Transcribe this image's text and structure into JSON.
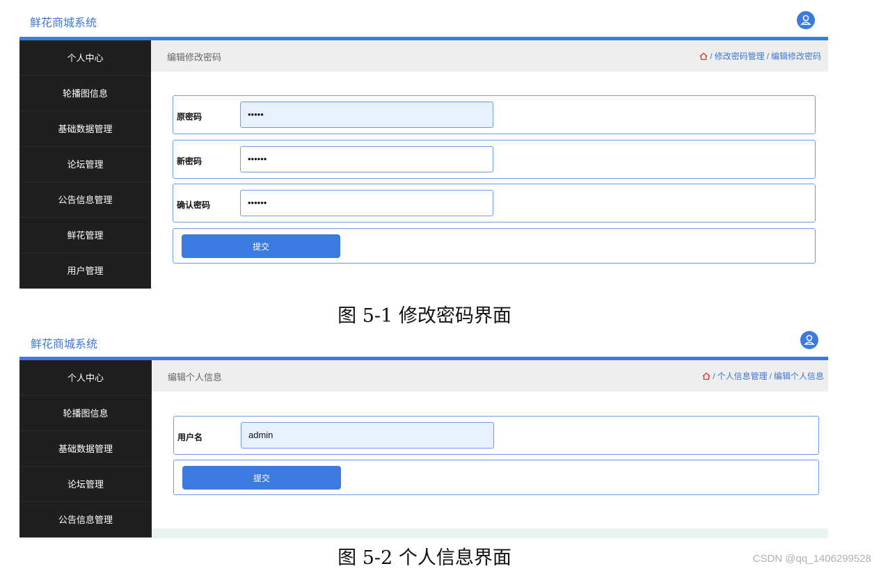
{
  "figures": [
    {
      "brand": "鲜花商城系统",
      "sidebar": [
        "个人中心",
        "轮播图信息",
        "基础数据管理",
        "论坛管理",
        "公告信息管理",
        "鲜花管理",
        "用户管理"
      ],
      "page_title": "编辑修改密码",
      "breadcrumb": [
        "修改密码管理",
        "编辑修改密码"
      ],
      "fields": [
        {
          "label": "原密码",
          "value": "•••••"
        },
        {
          "label": "新密码",
          "value": "••••••"
        },
        {
          "label": "确认密码",
          "value": "••••••"
        }
      ],
      "submit": "提交",
      "caption": "图 5-1 修改密码界面"
    },
    {
      "brand": "鲜花商城系统",
      "sidebar": [
        "个人中心",
        "轮播图信息",
        "基础数据管理",
        "论坛管理",
        "公告信息管理"
      ],
      "page_title": "编辑个人信息",
      "breadcrumb": [
        "个人信息管理",
        "编辑个人信息"
      ],
      "fields": [
        {
          "label": "用户名",
          "value": "admin"
        }
      ],
      "submit": "提交",
      "caption": "图 5-2 个人信息界面"
    }
  ],
  "watermark": "CSDN @qq_1406299528",
  "colors": {
    "accent": "#3b7be0",
    "sidebar": "#1f1f1f",
    "brand": "#3c78d8"
  },
  "icons": [
    "user-avatar-icon",
    "home-icon"
  ]
}
